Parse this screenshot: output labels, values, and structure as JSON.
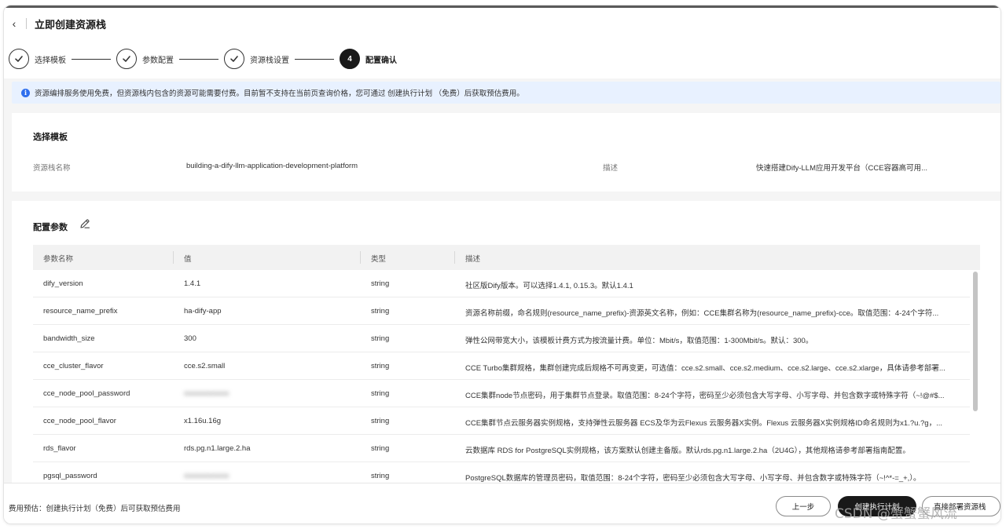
{
  "page": {
    "title": "立即创建资源栈",
    "back_icon": "chevron-left-icon"
  },
  "steps": [
    {
      "label": "选择模板",
      "state": "done"
    },
    {
      "label": "参数配置",
      "state": "done"
    },
    {
      "label": "资源栈设置",
      "state": "done"
    },
    {
      "label": "配置确认",
      "state": "active",
      "number": "4"
    }
  ],
  "alert": {
    "text": "资源编排服务使用免费，但资源栈内包含的资源可能需要付费。目前暂不支持在当前页查询价格，您可通过 创建执行计划 （免费）后获取预估费用。"
  },
  "template_section": {
    "title": "选择模板",
    "stack_name_label": "资源栈名称",
    "stack_name_value": "building-a-dify-llm-application-development-platform",
    "desc_label": "描述",
    "desc_value": "快速搭建Dify-LLM应用开发平台（CCE容器高可用..."
  },
  "params_section": {
    "title": "配置参数",
    "columns": [
      "参数名称",
      "值",
      "类型",
      "描述"
    ],
    "rows": [
      {
        "name": "dify_version",
        "value": "1.4.1",
        "type": "string",
        "desc": "社区版Dify版本。可以选择1.4.1, 0.15.3。默认1.4.1"
      },
      {
        "name": "resource_name_prefix",
        "value": "ha-dify-app",
        "type": "string",
        "desc": "资源名称前缀，命名规则(resource_name_prefix)-资源英文名称，例如：CCE集群名称为(resource_name_prefix)-cce。取值范围：4-24个字符..."
      },
      {
        "name": "bandwidth_size",
        "value": "300",
        "type": "string",
        "desc": "弹性公网带宽大小，该模板计费方式为按流量计费。单位：Mbit/s，取值范围：1-300Mbit/s。默认：300。"
      },
      {
        "name": "cce_cluster_flavor",
        "value": "cce.s2.small",
        "type": "string",
        "desc": "CCE Turbo集群规格，集群创建完成后规格不可再变更，可选值：cce.s2.small、cce.s2.medium、cce.s2.large、cce.s2.xlarge，具体请参考部署..."
      },
      {
        "name": "cce_node_pool_password",
        "value": "●●●●●●●●●●",
        "type": "string",
        "desc": "CCE集群node节点密码，用于集群节点登录。取值范围：8-24个字符，密码至少必须包含大写字母、小写字母、并包含数字或特殊字符（~!@#$...",
        "masked": true
      },
      {
        "name": "cce_node_pool_flavor",
        "value": "x1.16u.16g",
        "type": "string",
        "desc": "CCE集群节点云服务器实例规格，支持弹性云服务器 ECS及华为云Flexus 云服务器X实例。Flexus 云服务器X实例规格ID命名规则为x1.?u.?g，..."
      },
      {
        "name": "rds_flavor",
        "value": "rds.pg.n1.large.2.ha",
        "type": "string",
        "desc": "云数据库 RDS for PostgreSQL实例规格，该方案默认创建主备版。默认rds.pg.n1.large.2.ha（2U4G），其他规格请参考部署指南配置。"
      },
      {
        "name": "pgsql_password",
        "value": "●●●●●●●●●●",
        "type": "string",
        "desc": "PostgreSQL数据库的管理员密码，取值范围：8-24个字符，密码至少必须包含大写字母、小写字母、并包含数字或特殊字符（~!^*-=_+,）。",
        "masked": true
      }
    ]
  },
  "footer": {
    "fee_text": "费用预估：创建执行计划（免费）后可获取预估费用",
    "prev_label": "上一步",
    "create_plan_label": "创建执行计划",
    "deploy_label": "直接部署资源栈"
  },
  "watermark": "CSDN @蟹蟹蟹风流"
}
